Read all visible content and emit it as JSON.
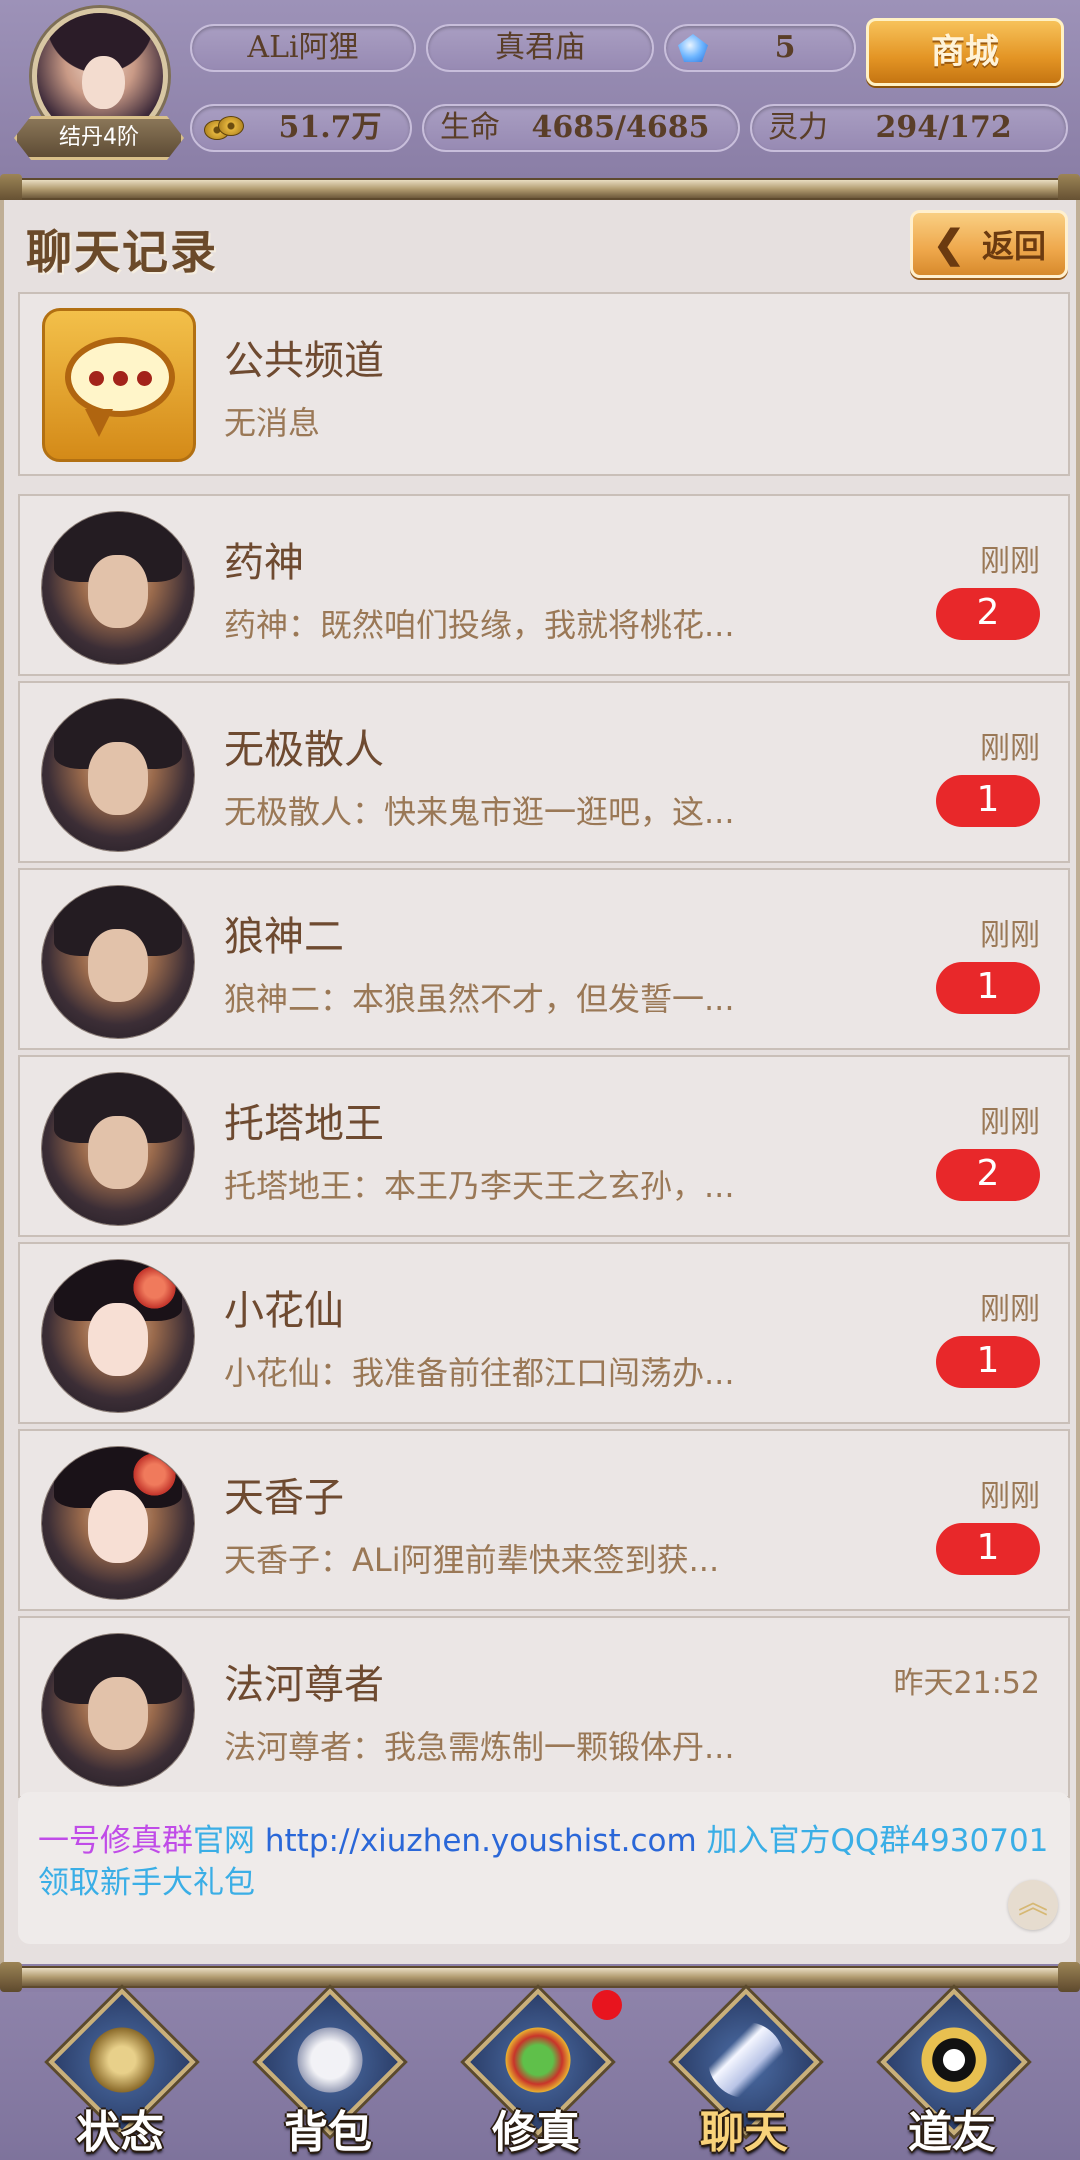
{
  "player": {
    "rank_badge": "结丹4阶",
    "name": "ALi阿狸",
    "location": "真君庙",
    "gems": "5",
    "coins": "51.7万",
    "hp_label": "生命",
    "hp_value": "4685/4685",
    "mp_label": "灵力",
    "mp_value": "294/172"
  },
  "shop_button": "商城",
  "panel": {
    "title": "聊天记录",
    "back_button": "返回",
    "back_chevron": "❮"
  },
  "public_channel": {
    "name": "公共频道",
    "preview": "无消息"
  },
  "chats": [
    {
      "name": "药神",
      "preview": "药神：既然咱们投缘，我就将桃花...",
      "time": "刚刚",
      "unread": "2"
    },
    {
      "name": "无极散人",
      "preview": "无极散人：快来鬼市逛一逛吧，这...",
      "time": "刚刚",
      "unread": "1"
    },
    {
      "name": "狼神二",
      "preview": "狼神二：本狼虽然不才，但发誓一...",
      "time": "刚刚",
      "unread": "1"
    },
    {
      "name": "托塔地王",
      "preview": "托塔地王：本王乃李天王之玄孙，...",
      "time": "刚刚",
      "unread": "2"
    },
    {
      "name": "小花仙",
      "preview": "小花仙：我准备前往都江口闯荡办...",
      "time": "刚刚",
      "unread": "1"
    },
    {
      "name": "天香子",
      "preview": "天香子：ALi阿狸前辈快来签到获...",
      "time": "刚刚",
      "unread": "1"
    },
    {
      "name": "法河尊者",
      "preview": "法河尊者：我急需炼制一颗锻体丹...",
      "time": "昨天21:52",
      "unread": ""
    }
  ],
  "notice": {
    "part1": "一号修真群",
    "part2": "官网",
    "part3": "http://xiuzhen.youshist.com",
    "part4": "加入官方QQ群4930701 领取新手大礼包"
  },
  "scroll_top_glyph": "︽",
  "nav": [
    {
      "label": "状态"
    },
    {
      "label": "背包"
    },
    {
      "label": "修真"
    },
    {
      "label": "聊天"
    },
    {
      "label": "道友"
    }
  ],
  "colors": {
    "unread_badge": "#e8282a",
    "active_nav_label": "#f8d27a",
    "notice_purple": "#c04ce8",
    "notice_cyan": "#3aaee6",
    "notice_link": "#2a67d8"
  }
}
